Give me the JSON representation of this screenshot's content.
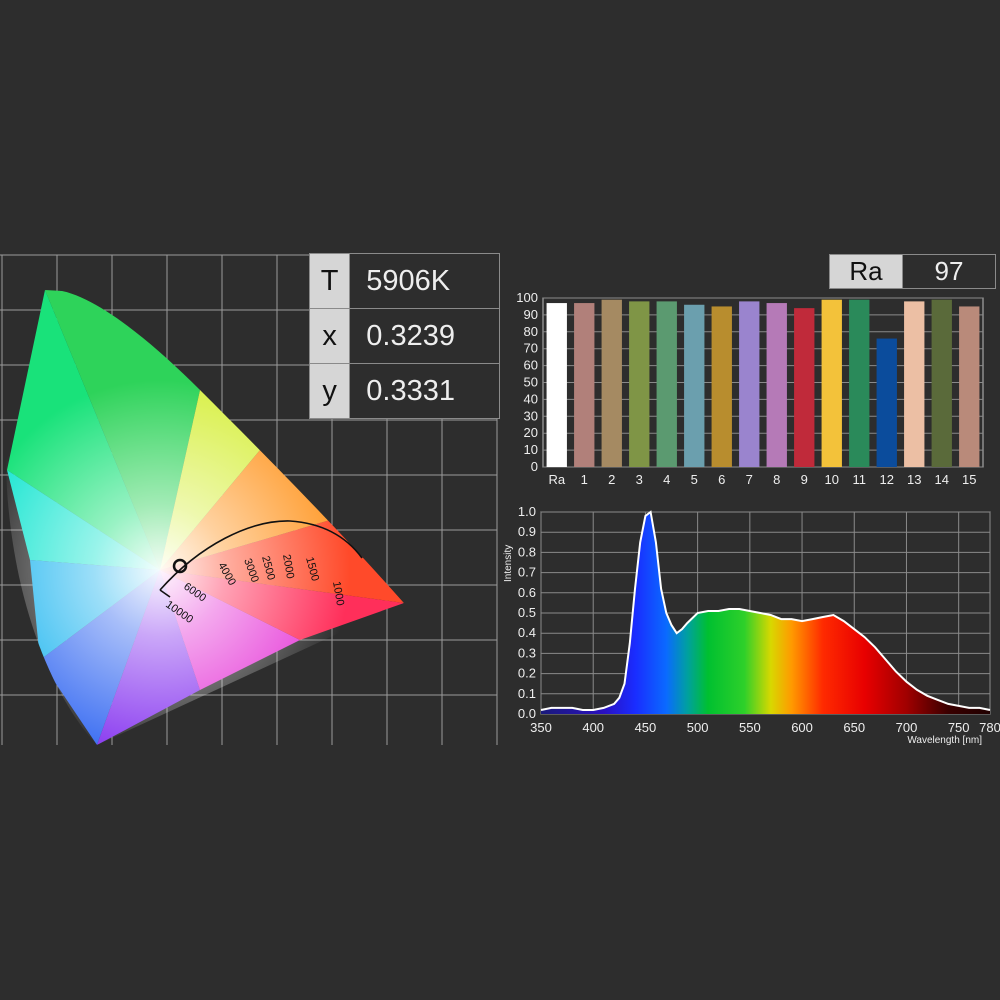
{
  "readout": {
    "rows": [
      {
        "key": "T",
        "value": "5906K"
      },
      {
        "key": "x",
        "value": "0.3239"
      },
      {
        "key": "y",
        "value": "0.3331"
      }
    ]
  },
  "cri_badge": {
    "key": "Ra",
    "value": "97"
  },
  "colors": {
    "background": "#2d2d2d",
    "grid": "#9a9a9a",
    "spd_line": "#ffffff"
  },
  "chart_data": [
    {
      "type": "scatter",
      "chart": "cie-1931-chromaticity",
      "point": {
        "x": 0.3239,
        "y": 0.3331
      },
      "cct_ticks": [
        "10000",
        "6000",
        "4000",
        "3000",
        "2500",
        "2000",
        "1500",
        "1000"
      ],
      "grid": true
    },
    {
      "type": "bar",
      "categories": [
        "Ra",
        "1",
        "2",
        "3",
        "4",
        "5",
        "6",
        "7",
        "8",
        "9",
        "10",
        "11",
        "12",
        "13",
        "14",
        "15"
      ],
      "values": [
        97,
        97,
        99,
        98,
        98,
        96,
        95,
        98,
        97,
        94,
        99,
        99,
        76,
        98,
        99,
        95
      ],
      "bar_colors": [
        "#ffffff",
        "#b1807a",
        "#a58a62",
        "#7f9546",
        "#5b9a70",
        "#6b9fae",
        "#b88d2e",
        "#9a84ce",
        "#b57ab7",
        "#c02a3a",
        "#f3c23a",
        "#2a8a5a",
        "#0b4c9c",
        "#ecbfa4",
        "#5a6a3a",
        "#b98a7a"
      ],
      "ylim": [
        0,
        100
      ],
      "yticks": [
        0,
        10,
        20,
        30,
        40,
        50,
        60,
        70,
        80,
        90,
        100
      ],
      "grid": true
    },
    {
      "type": "area",
      "xlabel": "Wavelength [nm]",
      "ylabel": "Intensity",
      "xlim": [
        350,
        780
      ],
      "ylim": [
        0,
        1.0
      ],
      "xticks": [
        350,
        400,
        450,
        500,
        550,
        600,
        650,
        700,
        750,
        780
      ],
      "yticks": [
        0.0,
        0.1,
        0.2,
        0.3,
        0.4,
        0.5,
        0.6,
        0.7,
        0.8,
        0.9,
        1.0
      ],
      "x": [
        350,
        360,
        370,
        380,
        390,
        400,
        410,
        420,
        425,
        430,
        435,
        440,
        445,
        450,
        455,
        460,
        465,
        470,
        475,
        480,
        485,
        490,
        500,
        510,
        520,
        530,
        540,
        550,
        560,
        570,
        580,
        590,
        600,
        610,
        620,
        630,
        640,
        650,
        660,
        670,
        680,
        690,
        700,
        710,
        720,
        730,
        740,
        750,
        760,
        770,
        780
      ],
      "y": [
        0.02,
        0.03,
        0.03,
        0.03,
        0.02,
        0.02,
        0.03,
        0.05,
        0.08,
        0.15,
        0.35,
        0.62,
        0.85,
        0.98,
        1.0,
        0.85,
        0.62,
        0.5,
        0.44,
        0.4,
        0.42,
        0.45,
        0.5,
        0.51,
        0.51,
        0.52,
        0.52,
        0.51,
        0.5,
        0.49,
        0.47,
        0.47,
        0.46,
        0.47,
        0.48,
        0.49,
        0.46,
        0.42,
        0.38,
        0.33,
        0.27,
        0.21,
        0.16,
        0.12,
        0.09,
        0.07,
        0.05,
        0.04,
        0.03,
        0.03,
        0.02
      ],
      "grid": true
    }
  ]
}
